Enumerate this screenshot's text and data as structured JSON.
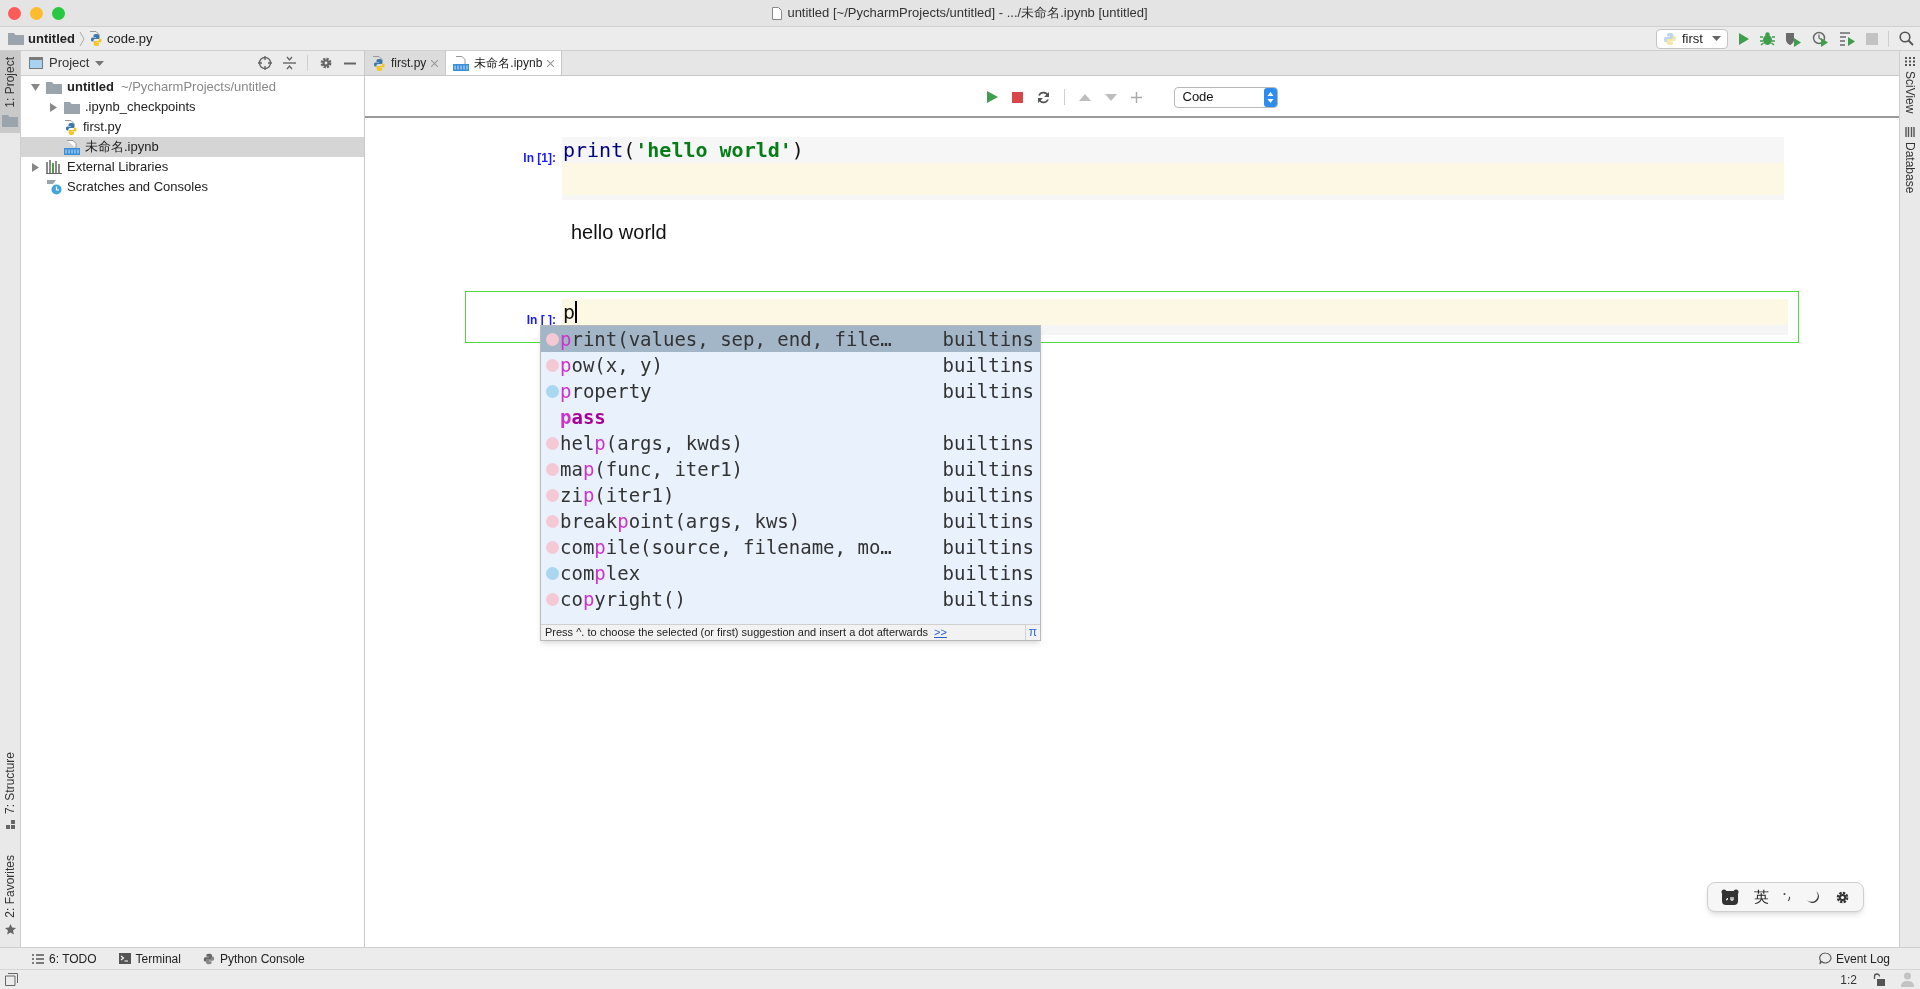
{
  "window": {
    "title": "untitled [~/PycharmProjects/untitled] - .../未命名.ipynb [untitled]"
  },
  "breadcrumbs": [
    {
      "label": "untitled",
      "kind": "folder"
    },
    {
      "label": "code.py",
      "kind": "python"
    }
  ],
  "run_config": {
    "label": "first"
  },
  "left_strip_top": [
    {
      "label": "1: Project",
      "kind": "folder",
      "selected": true
    }
  ],
  "left_strip_bottom": [
    {
      "label": "7: Structure",
      "kind": "structure",
      "selected": false
    },
    {
      "label": "2: Favorites",
      "kind": "star",
      "selected": false
    }
  ],
  "right_strip": [
    {
      "label": "SciView",
      "kind": "sciview"
    },
    {
      "label": "Database",
      "kind": "database"
    }
  ],
  "project_panel": {
    "title": "Project",
    "tree": [
      {
        "label": "untitled",
        "path": "~/PycharmProjects/untitled",
        "kind": "folder",
        "expanded": true,
        "selected": false,
        "children": [
          {
            "label": ".ipynb_checkpoints",
            "kind": "folder",
            "expanded": false,
            "selected": false
          },
          {
            "label": "first.py",
            "kind": "python",
            "selected": false
          },
          {
            "label": "未命名.ipynb",
            "kind": "notebook",
            "selected": true
          }
        ]
      },
      {
        "label": "External Libraries",
        "kind": "libraries",
        "expanded": false,
        "selected": false
      },
      {
        "label": "Scratches and Consoles",
        "kind": "scratches",
        "selected": false
      }
    ]
  },
  "editor_tabs": [
    {
      "label": "first.py",
      "kind": "python",
      "selected": false
    },
    {
      "label": "未命名.ipynb",
      "kind": "notebook",
      "selected": true
    }
  ],
  "notebook": {
    "cell_type": "Code",
    "cells": [
      {
        "prompt": "In [1]:",
        "active": false,
        "code": [
          {
            "text": "print",
            "kind": "builtin"
          },
          {
            "text": "(",
            "kind": "plain"
          },
          {
            "text": "'hello world'",
            "kind": "string"
          },
          {
            "text": ")",
            "kind": "plain"
          }
        ],
        "output": "hello world"
      },
      {
        "prompt": "In [ ]:",
        "active": true,
        "code": [
          {
            "text": "p",
            "kind": "plain"
          }
        ]
      }
    ]
  },
  "completion": {
    "items": [
      {
        "kind": "function",
        "match": "p",
        "after": "rint(values, sep, end, file…",
        "source": "builtins",
        "selected": true
      },
      {
        "kind": "function",
        "match": "p",
        "after": "ow(x, y)",
        "source": "builtins",
        "selected": false
      },
      {
        "kind": "class",
        "match": "p",
        "after": "roperty",
        "source": "builtins",
        "selected": false
      },
      {
        "kind": "keyword",
        "match": "p",
        "after": "ass",
        "selected": false
      },
      {
        "kind": "function",
        "before": "hel",
        "match": "p",
        "after": "(args, kwds)",
        "source": "builtins",
        "selected": false
      },
      {
        "kind": "function",
        "before": "ma",
        "match": "p",
        "after": "(func, iter1)",
        "source": "builtins",
        "selected": false
      },
      {
        "kind": "function",
        "before": "zi",
        "match": "p",
        "after": "(iter1)",
        "source": "builtins",
        "selected": false
      },
      {
        "kind": "function",
        "before": "break",
        "match": "p",
        "after": "oint(args, kws)",
        "source": "builtins",
        "selected": false
      },
      {
        "kind": "function",
        "before": "com",
        "match": "p",
        "after": "ile(source, filename, mo…",
        "source": "builtins",
        "selected": false
      },
      {
        "kind": "class",
        "before": "com",
        "match": "p",
        "after": "lex",
        "source": "builtins",
        "selected": false
      },
      {
        "kind": "function",
        "before": "co",
        "match": "p",
        "after": "yright()",
        "source": "builtins",
        "selected": false
      }
    ],
    "hint": "Press ^. to choose the selected (or first) suggestion and insert a dot afterwards",
    "hint_link": ">>",
    "pi": "π"
  },
  "bottom_tools": [
    {
      "label": "6: TODO",
      "kind": "todo"
    },
    {
      "label": "Terminal",
      "kind": "terminal"
    },
    {
      "label": "Python Console",
      "kind": "python"
    }
  ],
  "event_log": "Event Log",
  "status": {
    "position": "1:2"
  },
  "ime_toolbar": {
    "language": "英"
  }
}
